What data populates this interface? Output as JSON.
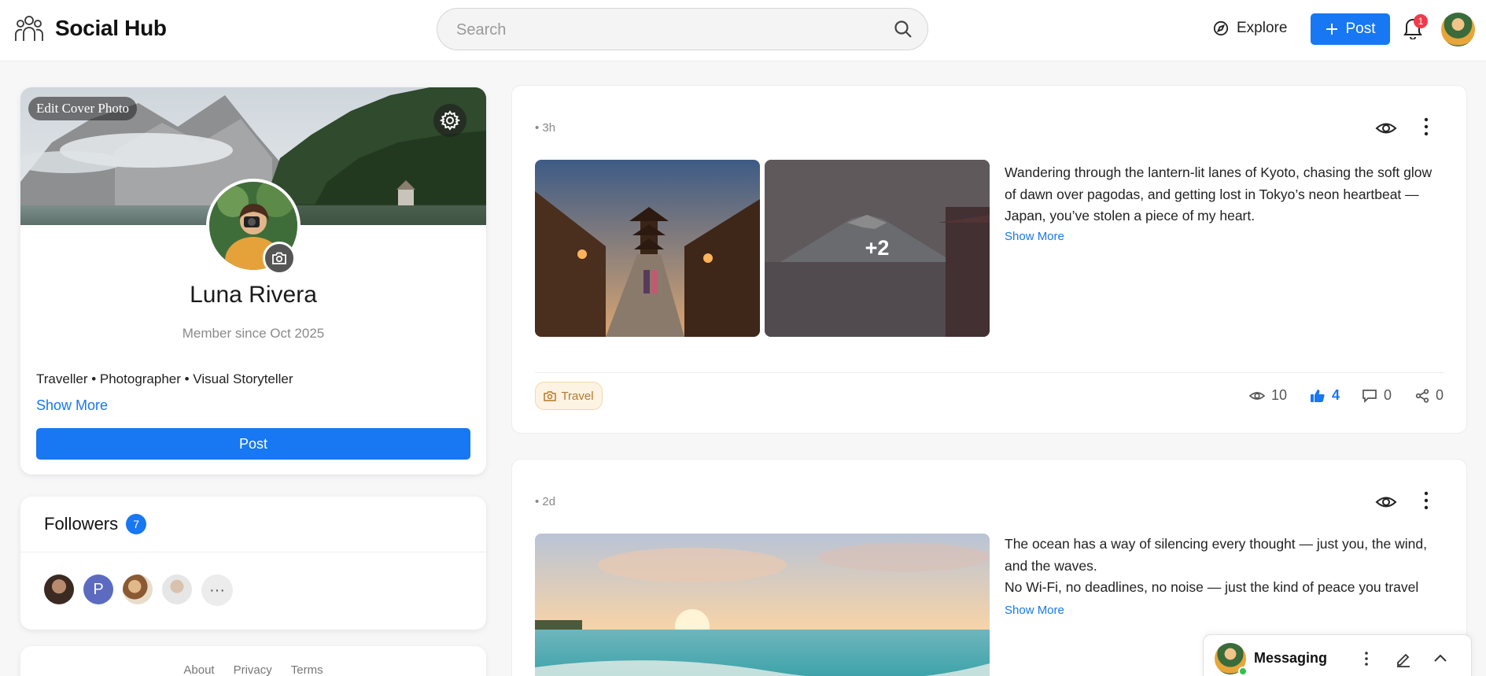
{
  "app": {
    "name": "Social Hub"
  },
  "topbar": {
    "search_placeholder": "Search",
    "explore_label": "Explore",
    "post_label": "Post",
    "notifications_count": "1"
  },
  "profile": {
    "cover_button": "Edit Cover Photo",
    "name": "Luna Rivera",
    "member_since": "Member since Oct 2025",
    "bio": "Traveller • Photographer • Visual Storyteller",
    "show_more": "Show More",
    "post_button": "Post"
  },
  "followers": {
    "title": "Followers",
    "count": "7",
    "more": "···",
    "items": [
      {
        "name": "follower-1",
        "color": "#6b4a3a"
      },
      {
        "name": "follower-2",
        "initial": "P",
        "color": "#5c6bc0"
      },
      {
        "name": "follower-3",
        "color": "#c9a27a"
      },
      {
        "name": "follower-4",
        "color": "#cfcfcf"
      }
    ]
  },
  "footer": {
    "links": [
      "About",
      "Privacy",
      "Terms"
    ]
  },
  "posts": [
    {
      "time": "• 3h",
      "text": "Wandering through the lantern-lit lanes of Kyoto, chasing the soft glow of dawn over pagodas, and getting lost in Tokyo’s neon heartbeat — Japan, you’ve stolen a piece of my heart.",
      "show_more": "Show More",
      "extra_images": "+2",
      "tag": "Travel",
      "views": "10",
      "likes": "4",
      "comments": "0",
      "shares": "0"
    },
    {
      "time": "• 2d",
      "text_line1": "The ocean has a way of silencing every thought — just you, the wind, and the waves.",
      "text_line2": "No Wi-Fi, no deadlines, no noise — just the kind of peace you travel",
      "show_more": "Show More"
    }
  ],
  "messaging": {
    "label": "Messaging"
  },
  "colors": {
    "accent": "#1877f2",
    "badge": "#ef3b4b",
    "tag_bg": "#fdf3e3",
    "tag_text": "#b7782a"
  }
}
